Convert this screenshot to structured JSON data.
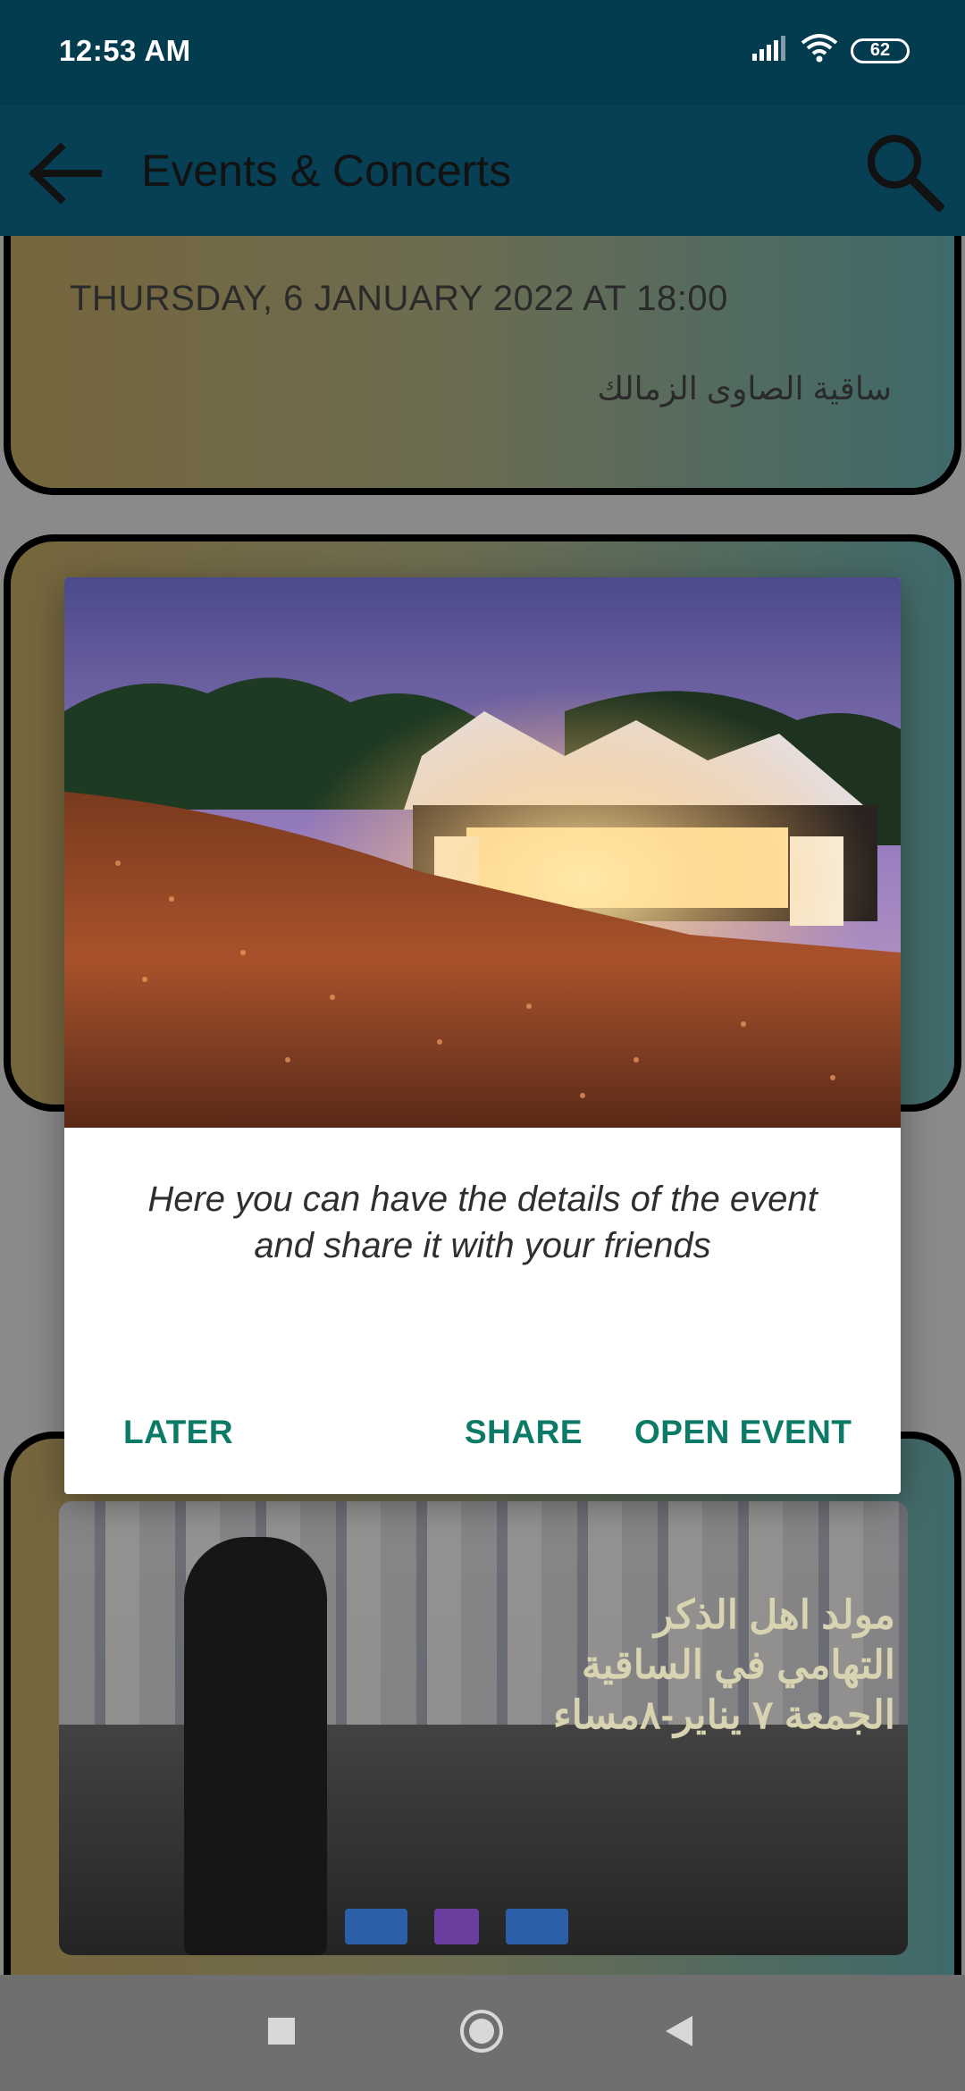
{
  "status_bar": {
    "time": "12:53 AM",
    "battery_level": "62"
  },
  "app_bar": {
    "title": "Events & Concerts",
    "back_icon": "arrow-left-icon",
    "search_icon": "search-icon"
  },
  "events": [
    {
      "date": "THURSDAY, 6 JANUARY 2022 AT 18:00",
      "venue": "ساقية الصاوى الزمالك"
    }
  ],
  "poster": {
    "headline_line1": "مولد اهل الذكر",
    "headline_line2": "التهامي في الساقية",
    "headline_line3": "الجمعة ٧ يناير-٨مساء"
  },
  "dialog": {
    "message": "Here you can have the details of the event and share it with your friends",
    "later_label": "LATER",
    "share_label": "SHARE",
    "open_event_label": "OPEN EVENT",
    "accent_color": "#0b7a66"
  },
  "colors": {
    "status_bar": "#033b4f",
    "app_bar": "#073f54",
    "accent": "#0b7a66"
  }
}
